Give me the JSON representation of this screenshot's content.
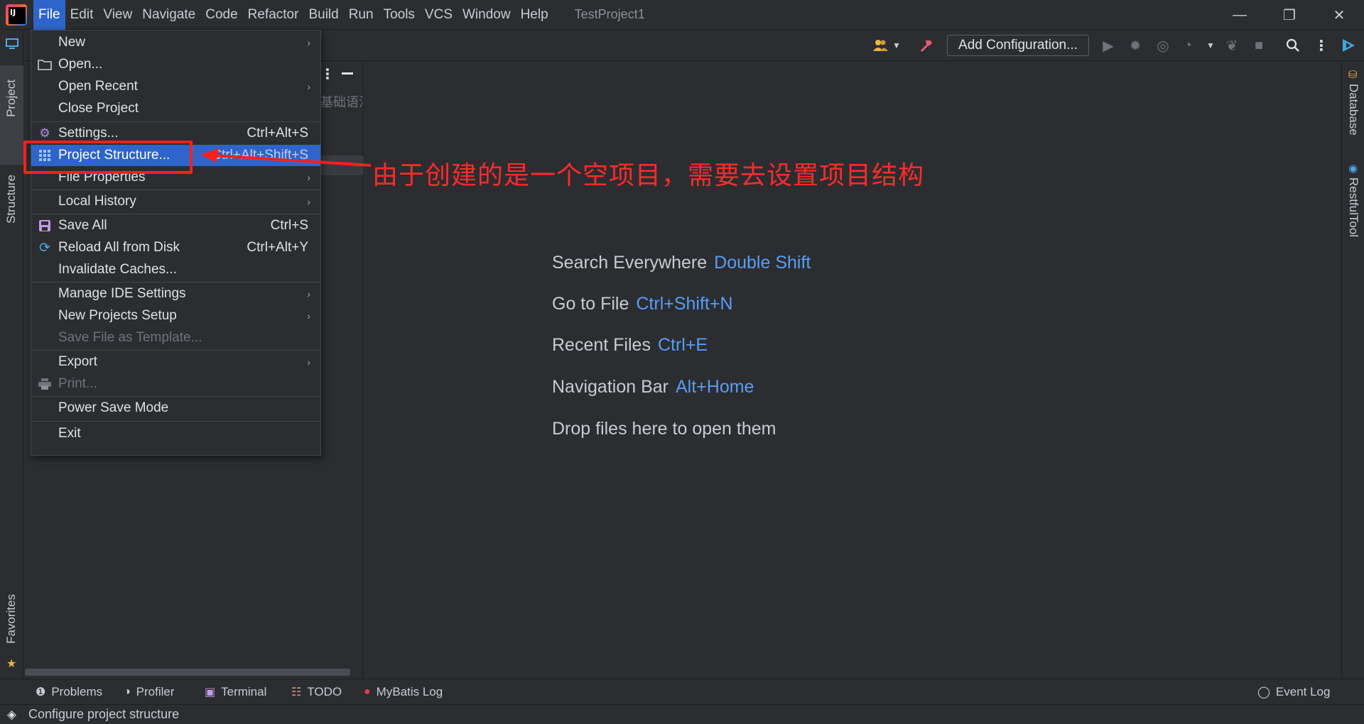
{
  "menubar": {
    "items": [
      "File",
      "Edit",
      "View",
      "Navigate",
      "Code",
      "Refactor",
      "Build",
      "Run",
      "Tools",
      "VCS",
      "Window",
      "Help"
    ],
    "project_title": "TestProject1"
  },
  "window_controls": {
    "minimize": "—",
    "restore": "❐",
    "close": "✕"
  },
  "toolbar": {
    "add_configuration": "Add Configuration...",
    "icons": [
      "users-icon",
      "hammer-icon",
      "run-icon",
      "debug-icon",
      "coverage-icon",
      "profile-icon",
      "dropdown-icon",
      "attach-icon",
      "stop-icon",
      "search-icon",
      "more-icon",
      "plugin-icon"
    ]
  },
  "left_tabs": {
    "project": "Project",
    "structure": "Structure",
    "favorites": "Favorites"
  },
  "right_tabs": {
    "database": "Database",
    "restful": "RestfulTool"
  },
  "project_panel": {
    "partial_text": "基础语法"
  },
  "file_menu": {
    "items": {
      "new": {
        "label": "New",
        "submenu": true
      },
      "open": {
        "label": "Open...",
        "icon": "folder-icon"
      },
      "open_recent": {
        "label": "Open Recent",
        "submenu": true
      },
      "close_project": {
        "label": "Close Project"
      },
      "settings": {
        "label": "Settings...",
        "shortcut": "Ctrl+Alt+S",
        "icon": "gear-icon"
      },
      "project_structure": {
        "label": "Project Structure...",
        "shortcut": "Ctrl+Alt+Shift+S",
        "icon": "grid-icon"
      },
      "file_properties": {
        "label": "File Properties",
        "submenu": true
      },
      "local_history": {
        "label": "Local History",
        "submenu": true
      },
      "save_all": {
        "label": "Save All",
        "shortcut": "Ctrl+S",
        "icon": "save-icon"
      },
      "reload_all": {
        "label": "Reload All from Disk",
        "shortcut": "Ctrl+Alt+Y",
        "icon": "reload-icon"
      },
      "invalidate_caches": {
        "label": "Invalidate Caches..."
      },
      "manage_ide_settings": {
        "label": "Manage IDE Settings",
        "submenu": true
      },
      "new_projects_setup": {
        "label": "New Projects Setup",
        "submenu": true
      },
      "save_as_template": {
        "label": "Save File as Template...",
        "disabled": true
      },
      "export": {
        "label": "Export",
        "submenu": true
      },
      "print": {
        "label": "Print...",
        "disabled": true,
        "icon": "printer-icon"
      },
      "power_save_mode": {
        "label": "Power Save Mode"
      },
      "exit": {
        "label": "Exit"
      }
    },
    "submenu_arrow": "›"
  },
  "annotation": {
    "text": "由于创建的是一个空项目，需要去设置项目结构",
    "color": "#ff2a2a"
  },
  "editor_hints": [
    {
      "label": "Search Everywhere",
      "key": "Double Shift"
    },
    {
      "label": "Go to File",
      "key": "Ctrl+Shift+N"
    },
    {
      "label": "Recent Files",
      "key": "Ctrl+E"
    },
    {
      "label": "Navigation Bar",
      "key": "Alt+Home"
    },
    {
      "label": "Drop files here to open them",
      "key": ""
    }
  ],
  "bottom_tabs": {
    "problems": "Problems",
    "profiler": "Profiler",
    "terminal": "Terminal",
    "todo": "TODO",
    "mybatis_log": "MyBatis Log",
    "event_log": "Event Log"
  },
  "status_bar": {
    "text": "Configure project structure"
  },
  "colors": {
    "accent": "#2f65ca",
    "link": "#589df6",
    "background": "#2b2d30",
    "annotation": "#ff2a2a"
  }
}
